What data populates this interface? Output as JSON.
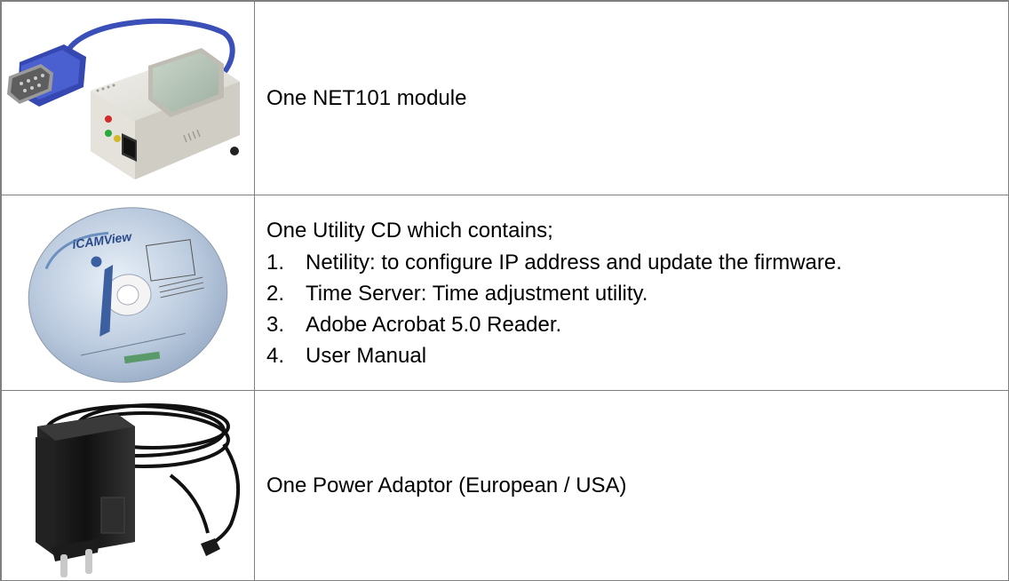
{
  "items": [
    {
      "icon": "net101-module-photo",
      "label": "One NET101 module"
    },
    {
      "icon": "utility-cd-photo",
      "label": "One Utility CD which contains;",
      "cd_label": "iCAMView",
      "contents": [
        {
          "num": "1.",
          "text": "Netility: to configure IP address and update the firmware."
        },
        {
          "num": "2.",
          "text": "Time Server: Time adjustment utility."
        },
        {
          "num": "3.",
          "text": "Adobe Acrobat 5.0 Reader."
        },
        {
          "num": "4.",
          "text": "User Manual"
        }
      ]
    },
    {
      "icon": "power-adaptor-photo",
      "label": "One Power Adaptor (European / USA)"
    }
  ],
  "colors": {
    "border": "#7f7f7f",
    "cable_blue": "#3b4fb8",
    "module_body": "#e6e4de",
    "adaptor": "#1a1a1a"
  }
}
